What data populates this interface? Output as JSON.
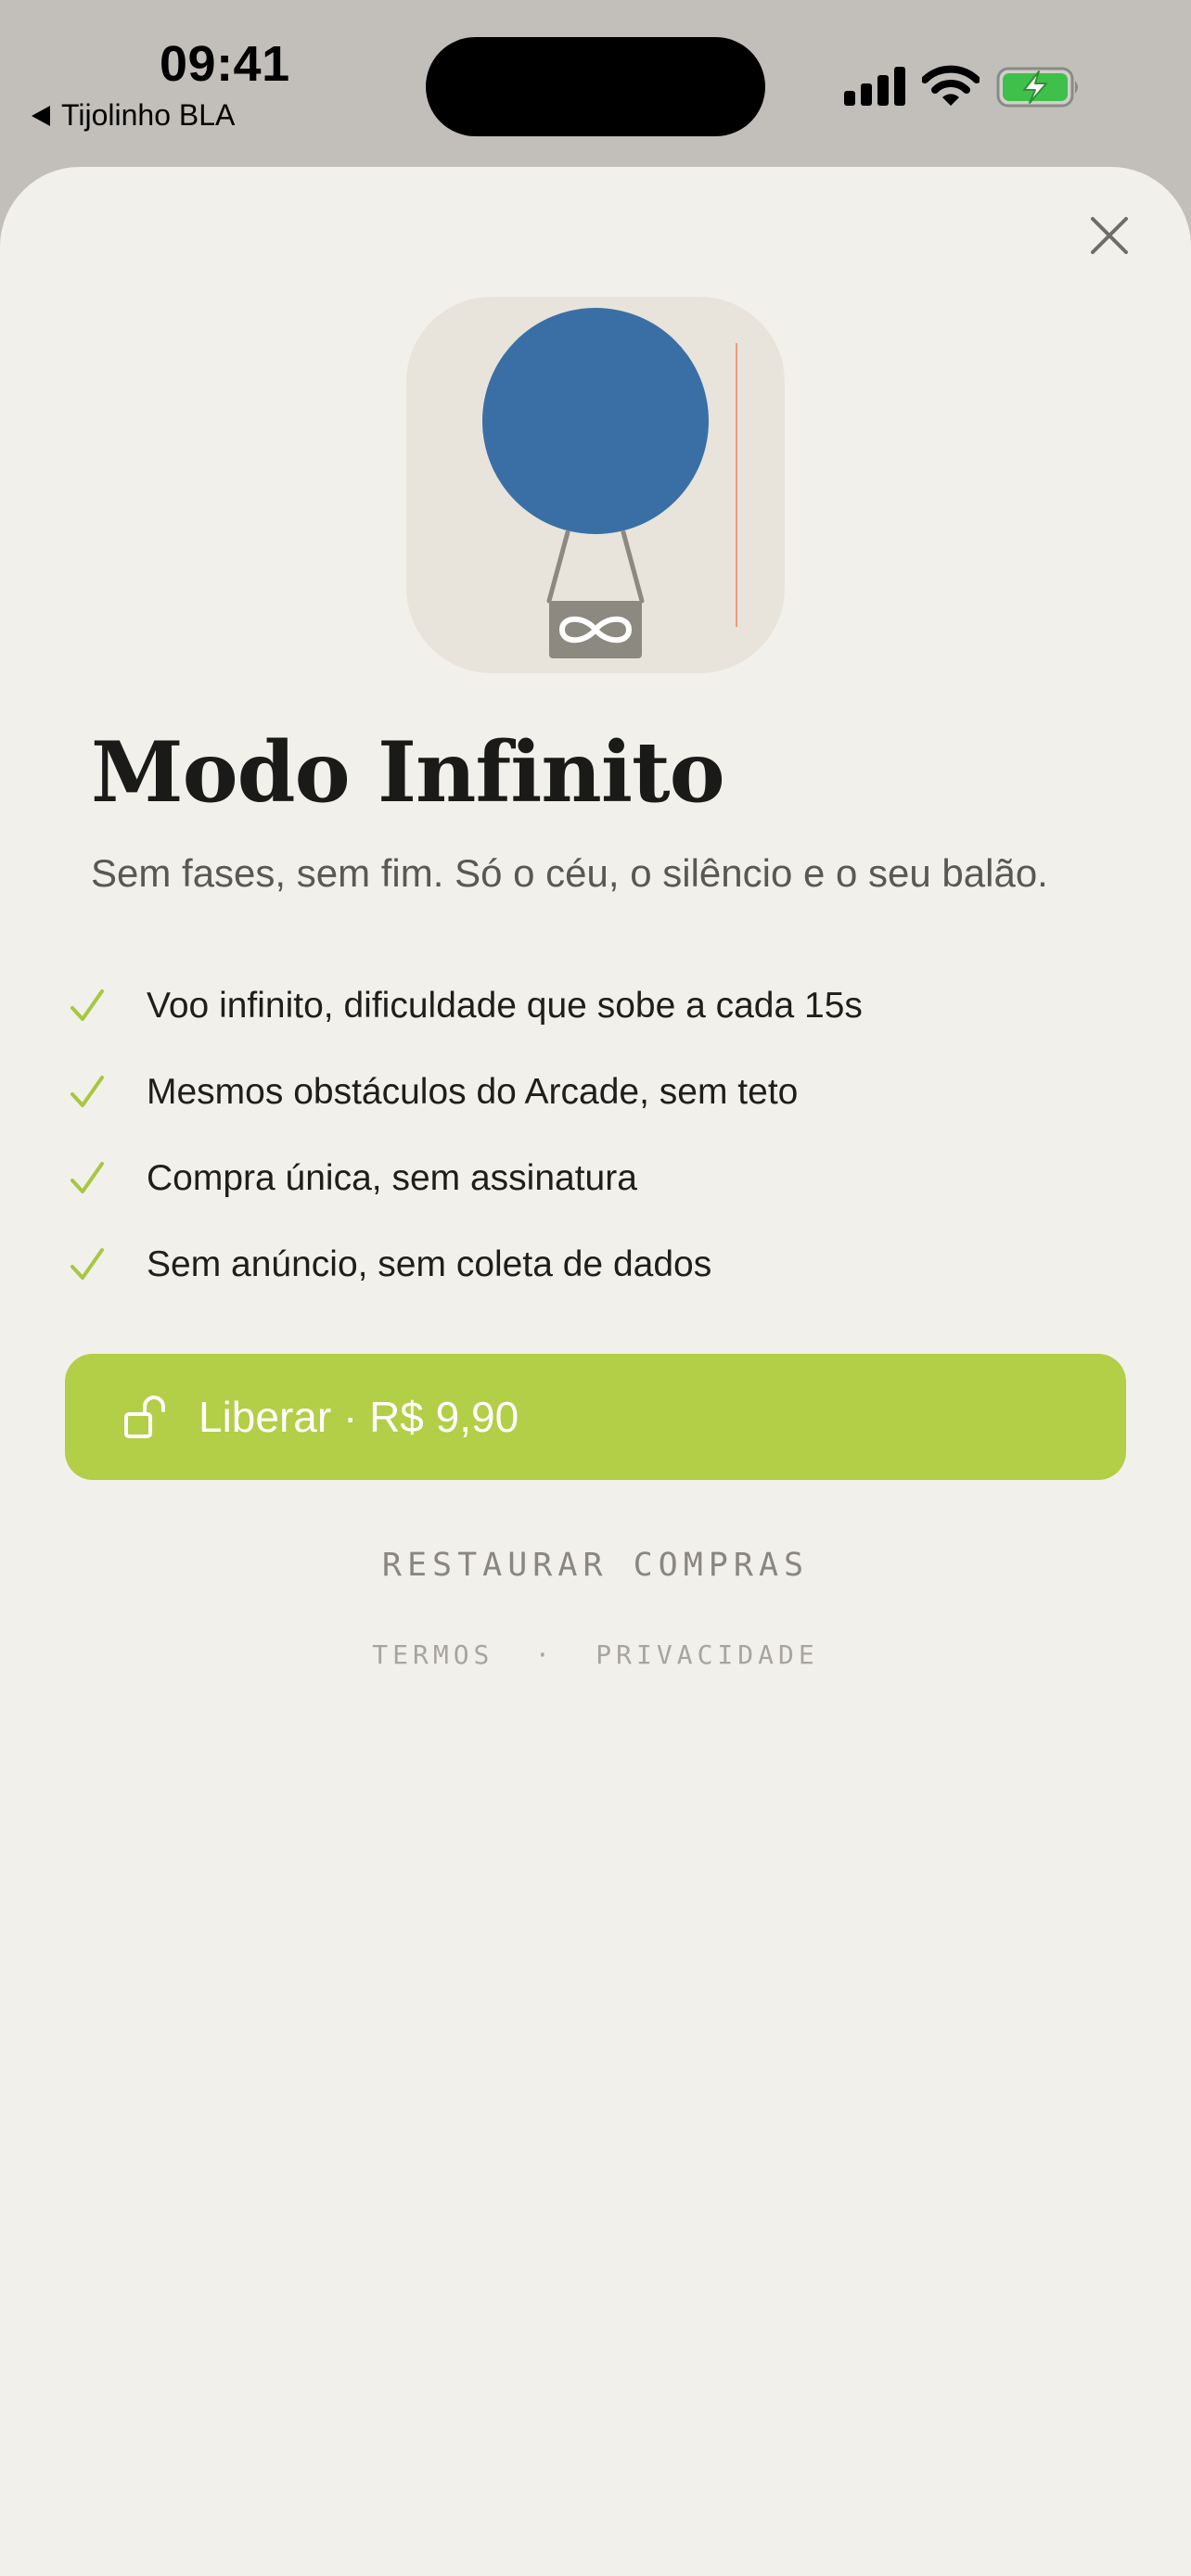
{
  "status_bar": {
    "time": "09:41",
    "back_label": "Tijolinho BLA"
  },
  "icons": {
    "signal": "cellular-signal-icon",
    "wifi": "wifi-icon",
    "battery": "battery-charging-icon",
    "close": "close-icon",
    "check": "checkmark-icon",
    "unlock": "unlock-icon",
    "app": "balloon-infinity-icon"
  },
  "colors": {
    "accent": "#b3ce47",
    "balloon": "#3a6fa6",
    "battery": "#3fc04a",
    "background": "#f2f0eb"
  },
  "paywall": {
    "title": "Modo Infinito",
    "subtitle": "Sem fases, sem fim. Só o céu, o silêncio e o seu balão.",
    "features": [
      "Voo infinito, dificuldade que sobe a cada 15s",
      "Mesmos obstáculos do Arcade, sem teto",
      "Compra única, sem assinatura",
      "Sem anúncio, sem coleta de dados"
    ],
    "cta_label": "Liberar · R$ 9,90",
    "restore_label": "RESTAURAR COMPRAS",
    "terms_label": "TERMOS",
    "separator": "·",
    "privacy_label": "PRIVACIDADE"
  }
}
